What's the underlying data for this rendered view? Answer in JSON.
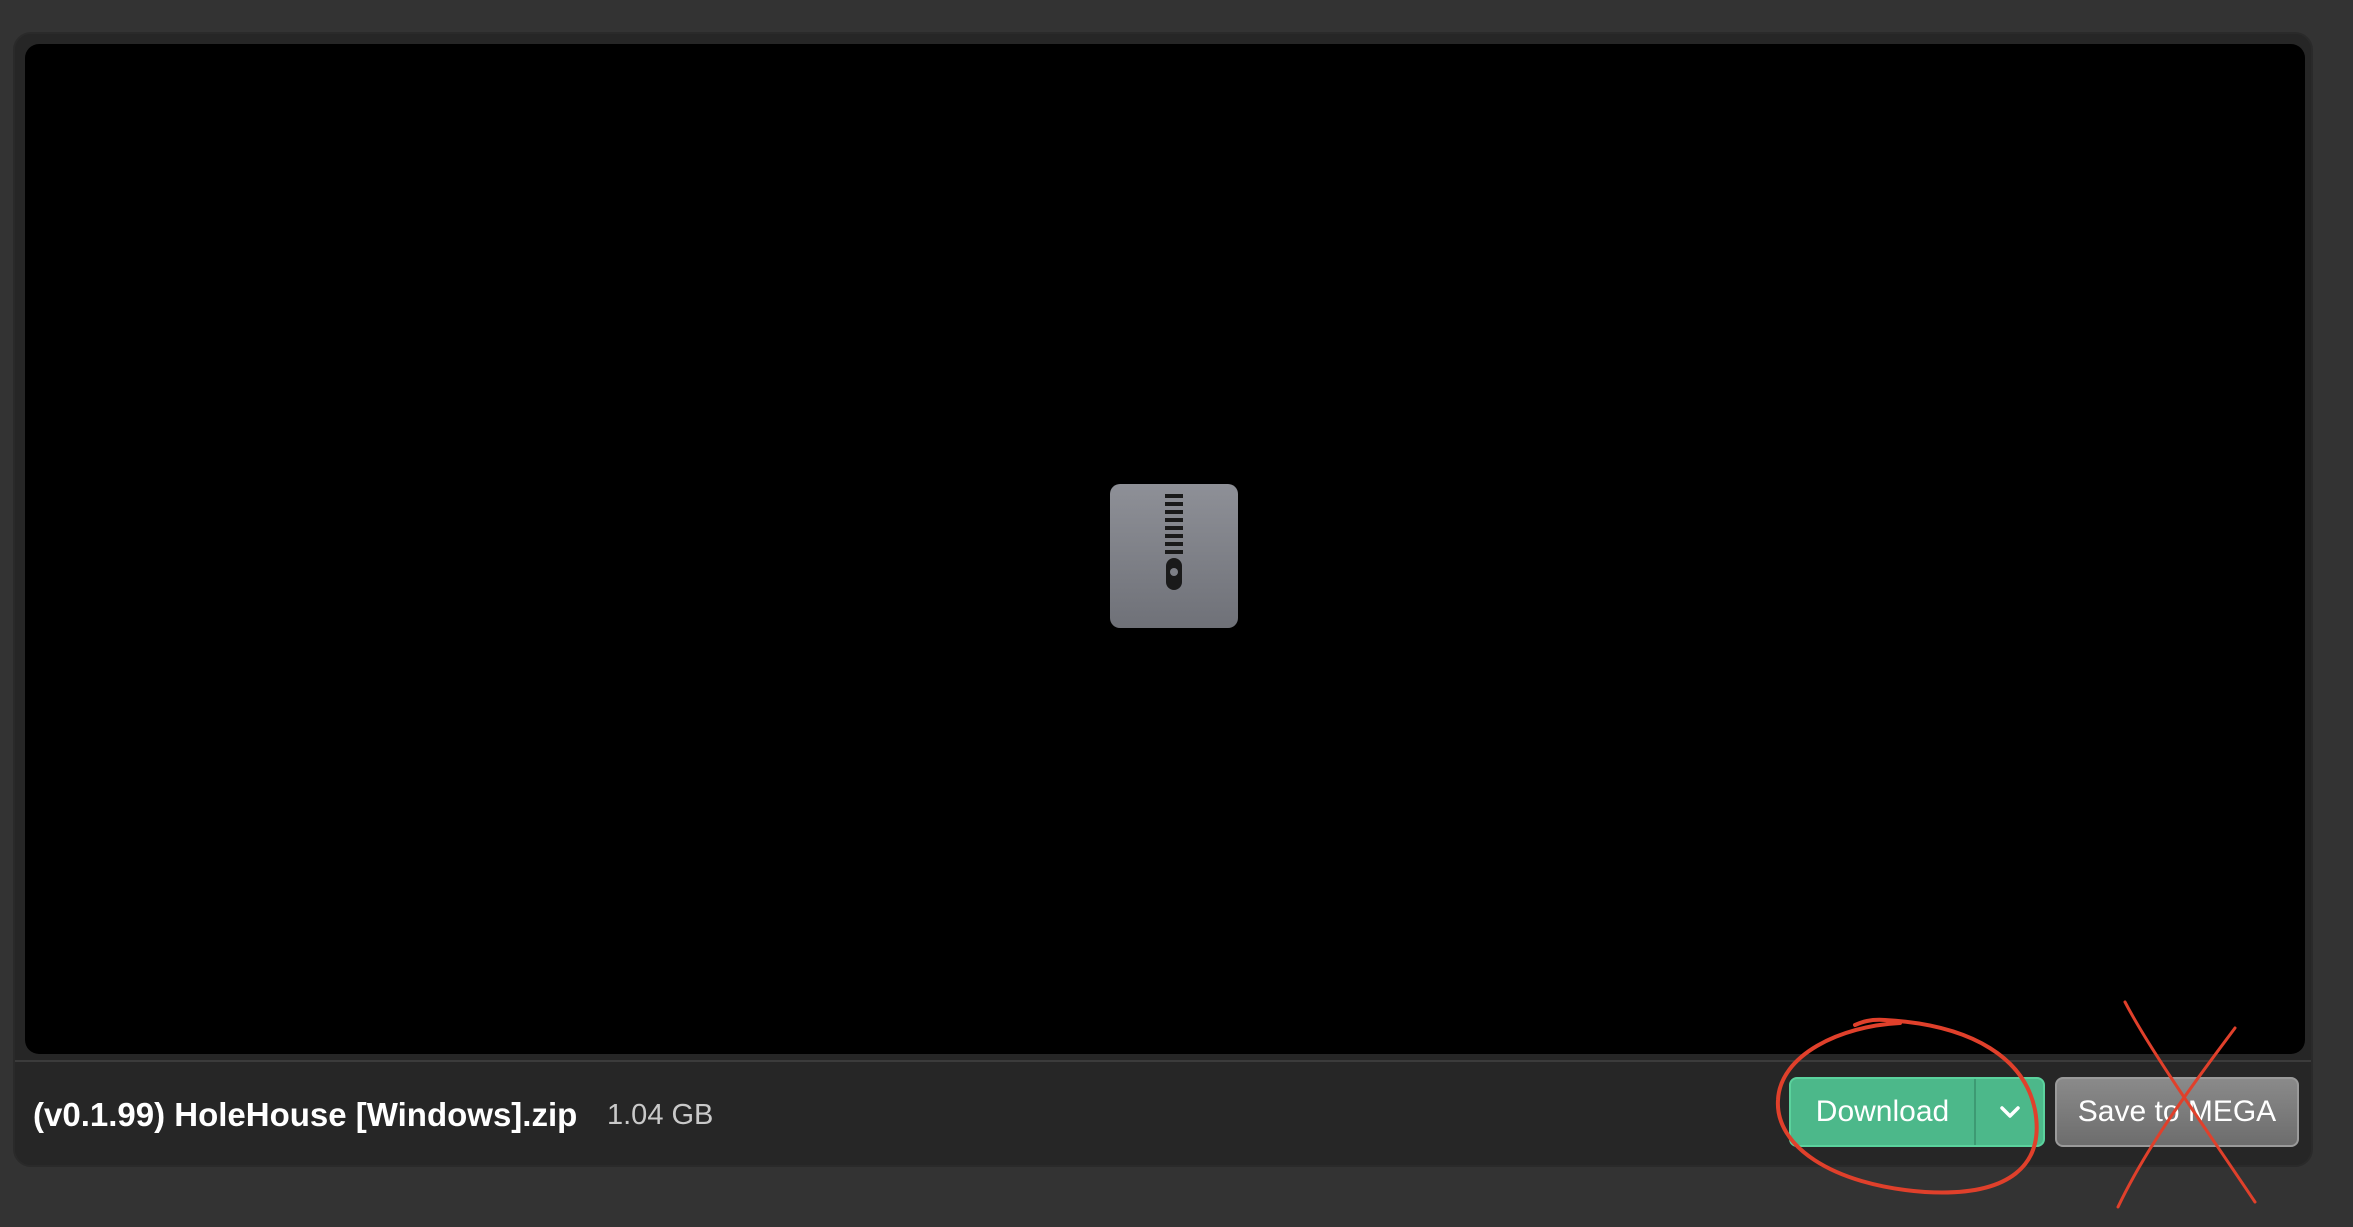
{
  "file": {
    "name": "(v0.1.99) HoleHouse [Windows].zip",
    "size": "1.04 GB"
  },
  "actions": {
    "download_label": "Download",
    "save_label": "Save to MEGA"
  },
  "colors": {
    "page_background": "#333333",
    "panel_background": "#262626",
    "preview_background": "#000000",
    "download_green": "#4cb88a",
    "save_gray": "#7a7a7a",
    "annotation_red": "#e0402b"
  },
  "icons": {
    "preview": "zip-archive-icon",
    "dropdown": "chevron-down-icon"
  },
  "annotations": [
    "circle-around-download",
    "cross-over-save-to-mega"
  ]
}
